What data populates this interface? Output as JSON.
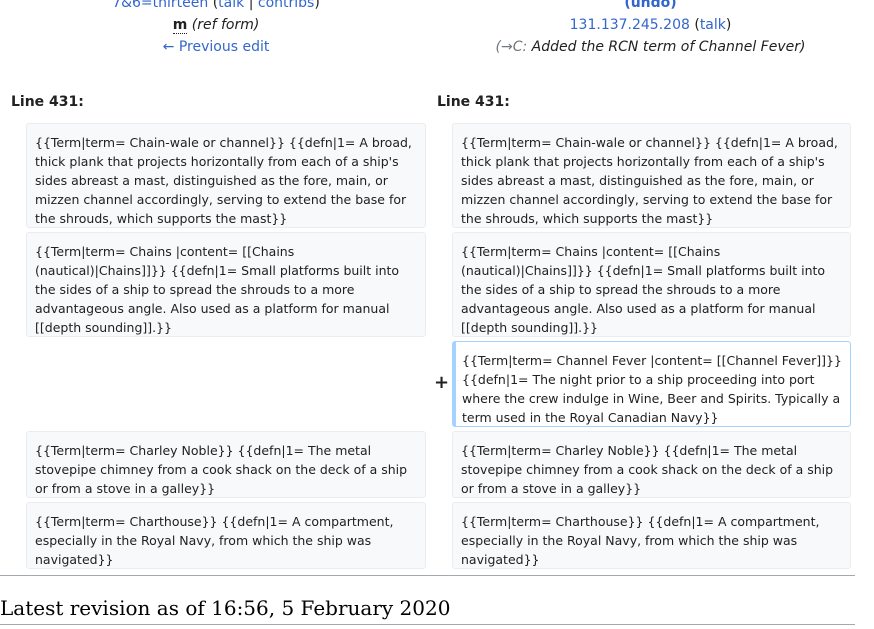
{
  "left_header": {
    "user_link": "7&6=thirteen",
    "talk_link": "talk",
    "sep": "|",
    "contribs_link": "contribs",
    "minor_flag": "m",
    "comment": "(ref form)",
    "prev_edit": "← Previous edit"
  },
  "right_header": {
    "undo_link": "(undo)",
    "ip_link": "131.137.245.208",
    "talk_link": "talk",
    "autocomment_arrow": "(→C:",
    "summary": " Added the RCN term of Channel Fever)"
  },
  "line_left": "Line 431:",
  "line_right": "Line 431:",
  "rows": [
    {
      "left": "{{Term|term= Chain-wale or channel}} {{defn|1= A broad, thick plank that projects horizontally from each of a ship's sides abreast a mast, distinguished as the fore, main, or mizzen channel accordingly, serving to extend the base for the shrouds, which supports the mast}}",
      "right": "{{Term|term= Chain-wale or channel}} {{defn|1= A broad, thick plank that projects horizontally from each of a ship's sides abreast a mast, distinguished as the fore, main, or mizzen channel accordingly, serving to extend the base for the shrouds, which supports the mast}}"
    },
    {
      "left": "{{Term|term= Chains |content= [[Chains (nautical)|Chains]]}} {{defn|1= Small platforms built into the sides of a ship to spread the shrouds to a more advantageous angle. Also used as a platform for manual [[depth sounding]].}}",
      "right": "{{Term|term= Chains |content= [[Chains (nautical)|Chains]]}} {{defn|1= Small platforms built into the sides of a ship to spread the shrouds to a more advantageous angle. Also used as a platform for manual [[depth sounding]].}}"
    },
    {
      "plus": "+",
      "right": "{{Term|term= Channel Fever |content= [[Channel Fever]]}} {{defn|1= The night prior to a ship proceeding into port where the crew indulge in Wine, Beer and Spirits. Typically a term used in the Royal Canadian Navy}}"
    },
    {
      "left": "{{Term|term= Charley Noble}} {{defn|1= The metal stovepipe chimney from a cook shack on the deck of a ship or from a stove in a galley}}",
      "right": "{{Term|term= Charley Noble}} {{defn|1= The metal stovepipe chimney from a cook shack on the deck of a ship or from a stove in a galley}}"
    },
    {
      "left": "{{Term|term= Charthouse}} {{defn|1= A compartment, especially in the Royal Navy, from which the ship was navigated}}",
      "right": "{{Term|term= Charthouse}} {{defn|1= A compartment, especially in the Royal Navy, from which the ship was navigated}}"
    }
  ],
  "latest_revision": "Latest revision as of 16:56, 5 February 2020"
}
